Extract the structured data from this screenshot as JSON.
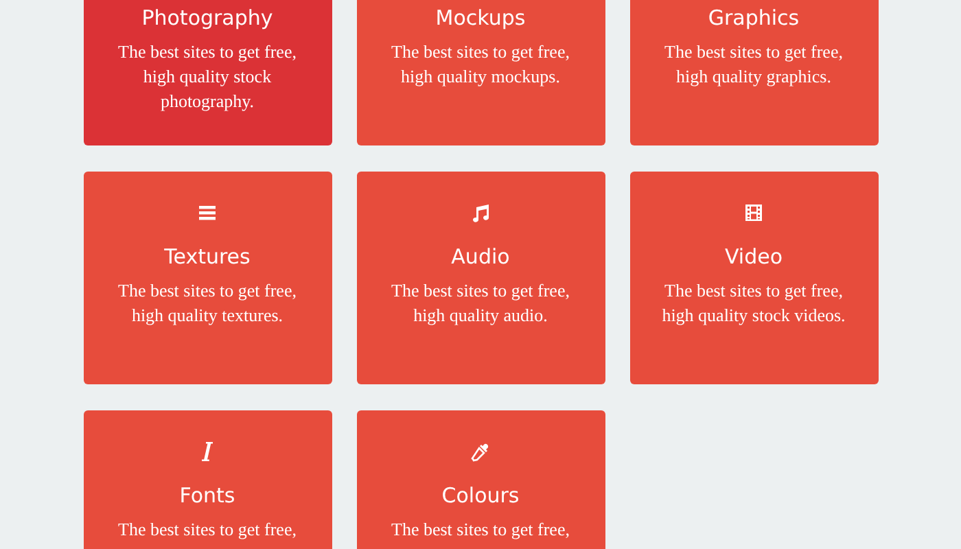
{
  "cards": [
    {
      "title": "Photography",
      "description": "The best sites to get free, high quality stock photography.",
      "selected": true
    },
    {
      "title": "Mockups",
      "description": "The best sites to get free, high quality mockups.",
      "selected": false
    },
    {
      "title": "Graphics",
      "description": "The best sites to get free, high quality graphics.",
      "selected": false
    },
    {
      "kind": "list",
      "title": "Textures",
      "description": "The best sites to get free, high quality textures.",
      "selected": false
    },
    {
      "kind": "music",
      "title": "Audio",
      "description": "The best sites to get free, high quality audio.",
      "selected": false
    },
    {
      "kind": "film",
      "title": "Video",
      "description": "The best sites to get free, high quality stock videos.",
      "selected": false
    },
    {
      "kind": "italic",
      "title": "Fonts",
      "description": "The best sites to get free,",
      "selected": false
    },
    {
      "kind": "eyedropper",
      "title": "Colours",
      "description": "The best sites to get free,",
      "selected": false
    }
  ]
}
